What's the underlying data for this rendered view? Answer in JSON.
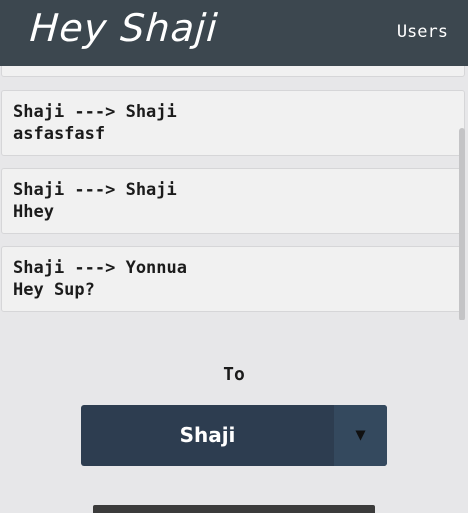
{
  "header": {
    "title": "Hey Shaji",
    "nav_users": "Users"
  },
  "messages": [
    {
      "route": "Shaji ---> Shaji",
      "text": "asfasfasf"
    },
    {
      "route": "Shaji ---> Shaji",
      "text": "Hhey"
    },
    {
      "route": "Shaji ---> Yonnua",
      "text": "Hey Sup?"
    }
  ],
  "compose": {
    "to_label": "To",
    "recipient": "Shaji",
    "dropdown_arrow": "▼",
    "arrow_icon": "caret-down-icon"
  },
  "colors": {
    "header_bg": "#3c474f",
    "select_bg": "#2d3d50",
    "select_arrow_bg": "#34495e"
  }
}
